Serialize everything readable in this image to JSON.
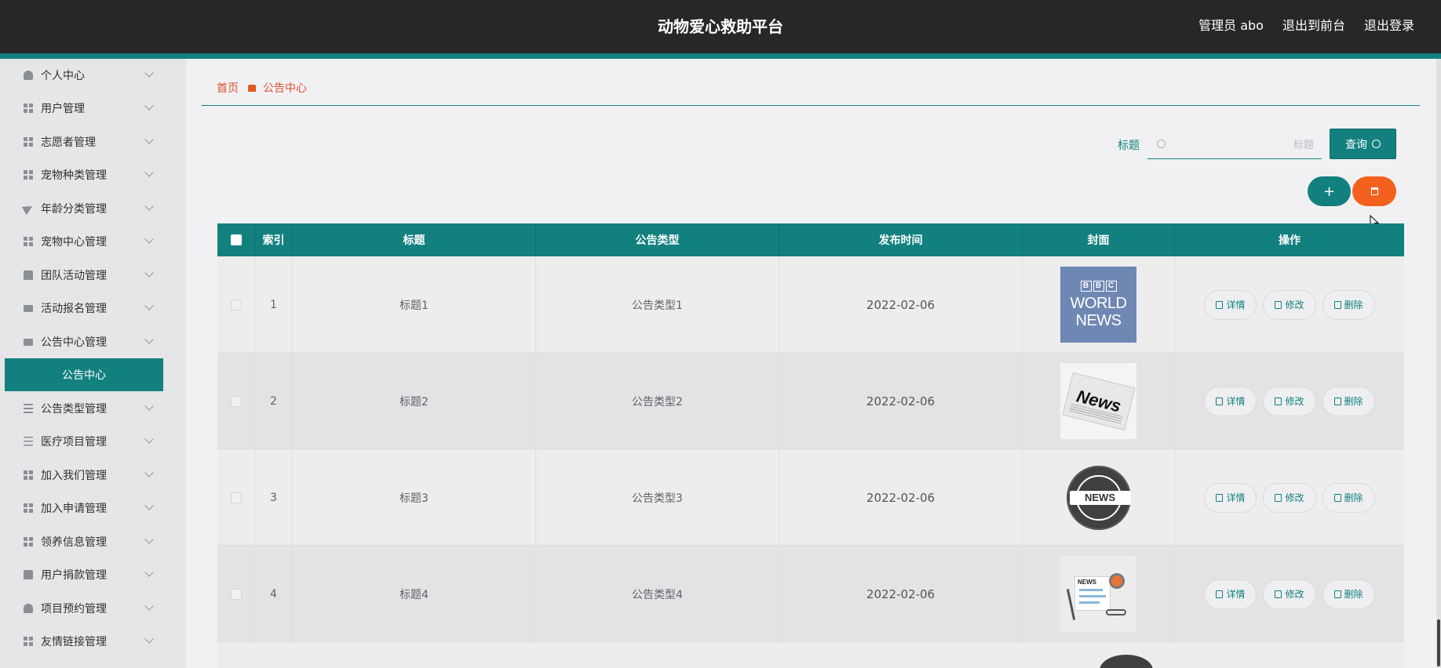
{
  "header": {
    "app_title": "动物爱心救助平台",
    "admin_label": "管理员 abo",
    "front_link": "退出到前台",
    "logout_link": "退出登录"
  },
  "sidebar": {
    "items": [
      {
        "label": "个人中心",
        "icon": "user-icon"
      },
      {
        "label": "用户管理",
        "icon": "grid-icon"
      },
      {
        "label": "志愿者管理",
        "icon": "grid-icon"
      },
      {
        "label": "宠物种类管理",
        "icon": "grid-icon"
      },
      {
        "label": "年龄分类管理",
        "icon": "send-icon"
      },
      {
        "label": "宠物中心管理",
        "icon": "grid-icon"
      },
      {
        "label": "团队活动管理",
        "icon": "clipboard-icon"
      },
      {
        "label": "活动报名管理",
        "icon": "monitor-icon"
      },
      {
        "label": "公告中心管理",
        "icon": "monitor-icon"
      },
      {
        "label": "公告类型管理",
        "icon": "list-icon"
      },
      {
        "label": "医疗项目管理",
        "icon": "sliders-icon"
      },
      {
        "label": "加入我们管理",
        "icon": "grid-icon"
      },
      {
        "label": "加入申请管理",
        "icon": "grid-icon"
      },
      {
        "label": "领养信息管理",
        "icon": "grid-icon"
      },
      {
        "label": "用户捐款管理",
        "icon": "clipboard-icon"
      },
      {
        "label": "项目预约管理",
        "icon": "user-icon"
      },
      {
        "label": "友情链接管理",
        "icon": "grid-icon"
      }
    ],
    "active_submenu": "公告中心"
  },
  "breadcrumb": {
    "home": "首页",
    "current": "公告中心"
  },
  "search": {
    "label": "标题",
    "placeholder": "标题",
    "value": "",
    "query_button": "查询"
  },
  "actions": {
    "add_label": "+"
  },
  "table": {
    "headers": {
      "index": "索引",
      "title": "标题",
      "type": "公告类型",
      "time": "发布时间",
      "cover": "封面",
      "ops": "操作"
    },
    "rows": [
      {
        "index": "1",
        "title": "标题1",
        "type": "公告类型1",
        "time": "2022-02-06",
        "cover": "bbc-world-news"
      },
      {
        "index": "2",
        "title": "标题2",
        "type": "公告类型2",
        "time": "2022-02-06",
        "cover": "newspaper"
      },
      {
        "index": "3",
        "title": "标题3",
        "type": "公告类型3",
        "time": "2022-02-06",
        "cover": "news-globe"
      },
      {
        "index": "4",
        "title": "标题4",
        "type": "公告类型4",
        "time": "2022-02-06",
        "cover": "news-illustration"
      }
    ],
    "op_labels": {
      "detail": "详情",
      "edit": "修改",
      "delete": "删除"
    }
  },
  "covers": {
    "bbc_logo": [
      "B",
      "B",
      "C"
    ],
    "bbc_text_1": "WORLD",
    "bbc_text_2": "NEWS",
    "paper_text": "News",
    "globe_text": "NEWS",
    "illus_text": "NEWS"
  },
  "colors": {
    "primary": "#12807f",
    "danger": "#f2611d",
    "topbar": "#272727"
  }
}
